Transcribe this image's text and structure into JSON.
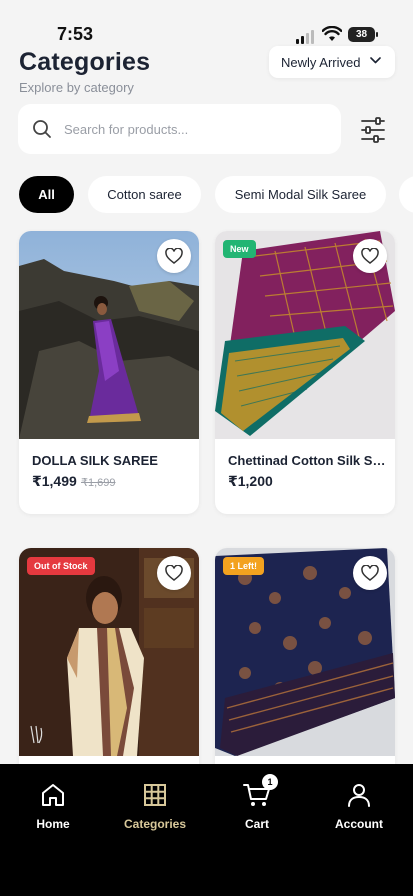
{
  "status": {
    "time": "7:53",
    "battery": "38"
  },
  "header": {
    "title": "Categories",
    "subtitle": "Explore by category",
    "sort_label": "Newly Arrived"
  },
  "search": {
    "placeholder": "Search for products..."
  },
  "chips": [
    {
      "label": "All",
      "active": true
    },
    {
      "label": "Cotton saree",
      "active": false
    },
    {
      "label": "Semi Modal Silk Saree",
      "active": false
    }
  ],
  "products": [
    {
      "name": "DOLLA SILK SAREE",
      "price": "₹1,499",
      "old_price": "₹1,699",
      "badge": ""
    },
    {
      "name": "Chettinad Cotton Silk Saree",
      "price": "₹1,200",
      "old_price": "",
      "badge": "New",
      "badge_color": "#22b573"
    },
    {
      "name": "",
      "price": "",
      "old_price": "",
      "badge": "Out of Stock",
      "badge_color": "#e5393f"
    },
    {
      "name": "",
      "price": "",
      "old_price": "",
      "badge": "1 Left!",
      "badge_color": "#f3a21f"
    }
  ],
  "bottom_nav": [
    {
      "label": "Home",
      "icon": "home-icon"
    },
    {
      "label": "Categories",
      "icon": "grid-icon",
      "active": true
    },
    {
      "label": "Cart",
      "icon": "cart-icon",
      "count": "1"
    },
    {
      "label": "Account",
      "icon": "user-icon"
    }
  ],
  "colors": {
    "accent_active_nav": "#d8c89a",
    "background": "#f4f4f4"
  }
}
